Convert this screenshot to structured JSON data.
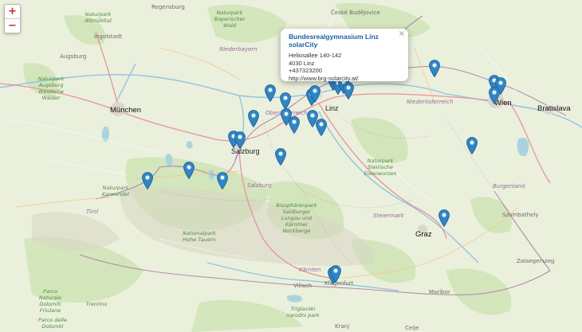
{
  "zoom": {
    "in_label": "+",
    "out_label": "−"
  },
  "popup": {
    "title": "Bundesrealgymnasium Linz solarCity",
    "street": "Heliosallee 140-142",
    "city": "4030 Linz",
    "phone": "+437323200",
    "url": "http://www.brg-solarcity.at/",
    "close_label": "×"
  },
  "marker_icon": "map-pin-icon",
  "marker_color": "#2e86c9",
  "map_labels": {
    "regensburg": "Regensburg",
    "ceske_budejovice": "České Budějovice",
    "ingolstadt": "Ingolstadt",
    "naturpark_altmuehltal": "Naturpark Altmühltal",
    "naturpark_bayerischer_wald": "Naturpark Bayerischer Wald",
    "niederbayern": "Niederbayern",
    "augsburg": "Augsburg",
    "naturpark_augsburg": "Naturpark Augsburg Westliche Wälder",
    "muenchen": "München",
    "linz": "Linz",
    "oberoesterreich": "Oberösterreich",
    "niederoesterreich": "Niederösterreich",
    "wien": "Wien",
    "bratislava": "Bratislava",
    "salzburg_city": "Salzburg",
    "salzburg_region": "Salzburg",
    "naturpark_eisenwurzen": "Naturpark Steirische Eisenwurzen",
    "burgenland": "Burgenland",
    "naturpark_karwendel": "Naturpark Karwendel",
    "biosphaerenpark": "Biosphärenpark Salzburger Lungau und Kärntner Nockberge",
    "steiermark": "Steiermark",
    "szombathely": "Szombathely",
    "graz": "Graz",
    "naturpark_hohe_tauern": "Nationalpark Hohe Tauern",
    "tirol": "Tirol",
    "kaernten": "Kärnten",
    "villach": "Villach",
    "klagenfurt": "Klagenfurt",
    "maribor": "Maribor",
    "zalaegerszeg": "Zalaegerszeg",
    "naturpark_julische": "Parco Naturale Dolomiti Friulane",
    "trentino": "Trentino",
    "triglav": "Triglavski narodni park",
    "kranj": "Kranj",
    "celje": "Celje",
    "parco_dolomiti": "Parco delle Dolomiti"
  }
}
